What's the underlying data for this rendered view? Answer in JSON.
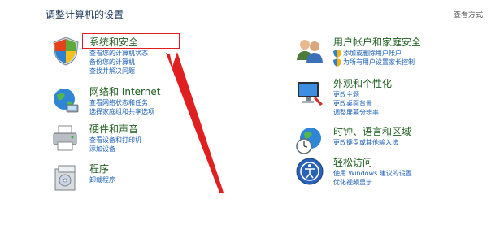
{
  "header": {
    "title": "调整计算机的设置",
    "view_by": "查看方式:"
  },
  "categories": [
    {
      "key": "security",
      "title": "系统和安全",
      "icon": "shield-icon",
      "links": [
        "查看您的计算机状态",
        "备份您的计算机",
        "查找并解决问题"
      ]
    },
    {
      "key": "network",
      "title": "网络和 Internet",
      "icon": "network-globe-icon",
      "links": [
        "查看网络状态和任务",
        "选择家庭组和共享选项"
      ]
    },
    {
      "key": "hardware",
      "title": "硬件和声音",
      "icon": "printer-icon",
      "links": [
        "查看设备和打印机",
        "添加设备"
      ]
    },
    {
      "key": "programs",
      "title": "程序",
      "icon": "programs-box-icon",
      "links": [
        "卸载程序"
      ]
    },
    {
      "key": "users",
      "title": "用户帐户和家庭安全",
      "icon": "users-icon",
      "links": [
        "添加或删除用户帐户",
        "为所有用户设置家长控制"
      ]
    },
    {
      "key": "appearance",
      "title": "外观和个性化",
      "icon": "monitor-brush-icon",
      "links": [
        "更改主题",
        "更改桌面背景",
        "调整屏幕分辨率"
      ]
    },
    {
      "key": "clock",
      "title": "时钟、语言和区域",
      "icon": "clock-globe-icon",
      "links": [
        "更改键盘或其他输入法"
      ]
    },
    {
      "key": "ease",
      "title": "轻松访问",
      "icon": "ease-of-access-icon",
      "links": [
        "使用 Windows 建议的设置",
        "优化视频显示"
      ]
    }
  ],
  "annotation": {
    "highlight_color": "#e02020"
  }
}
